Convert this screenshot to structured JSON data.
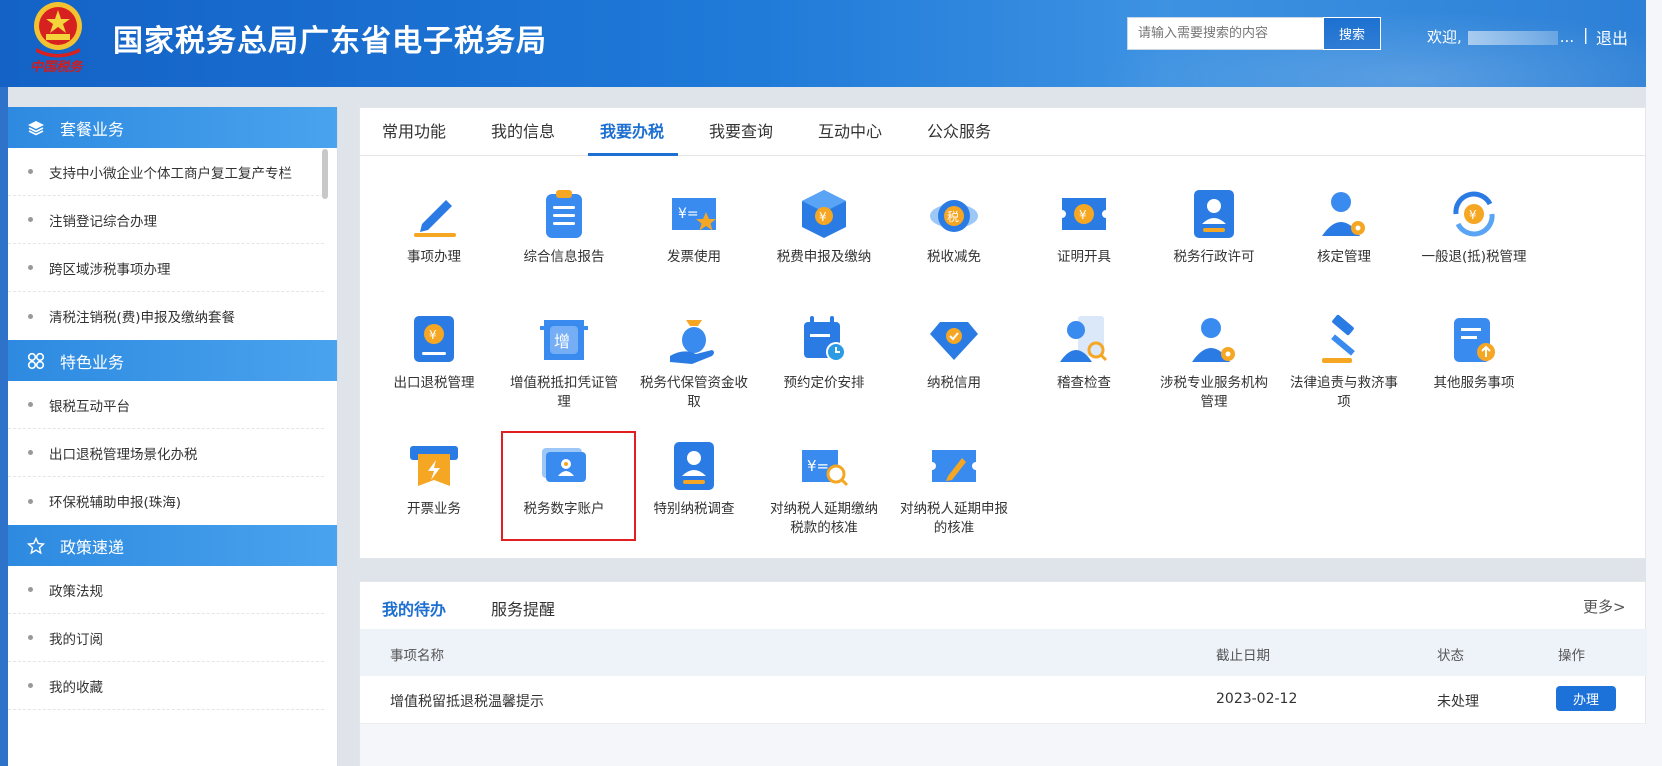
{
  "header": {
    "logo_script": "中国税务",
    "site_title": "国家税务总局广东省电子税务局",
    "search_placeholder": "请输入需要搜索的内容",
    "search_button": "搜索",
    "welcome": "欢迎,",
    "welcome_dots": "...",
    "separator": "|",
    "logout": "退出"
  },
  "sidebar": {
    "sections": [
      {
        "title": "套餐业务",
        "icon": "layers-icon",
        "items": [
          "支持中小微企业个体工商户复工复产专栏",
          "注销登记综合办理",
          "跨区域涉税事项办理",
          "清税注销税(费)申报及缴纳套餐"
        ]
      },
      {
        "title": "特色业务",
        "icon": "apps-icon",
        "items": [
          "银税互动平台",
          "出口退税管理场景化办税",
          "环保税辅助申报(珠海)"
        ]
      },
      {
        "title": "政策速递",
        "icon": "star-icon",
        "items": [
          "政策法规",
          "我的订阅",
          "我的收藏"
        ]
      }
    ]
  },
  "main": {
    "tabs": [
      "常用功能",
      "我的信息",
      "我要办税",
      "我要查询",
      "互动中心",
      "公众服务"
    ],
    "active_tab": "我要办税",
    "functions": [
      {
        "label": "事项办理",
        "icon": "pen-icon"
      },
      {
        "label": "综合信息报告",
        "icon": "clipboard-icon"
      },
      {
        "label": "发票使用",
        "icon": "invoice-star-icon"
      },
      {
        "label": "税费申报及缴纳",
        "icon": "box-yuan-icon"
      },
      {
        "label": "税收减免",
        "icon": "tax-reduction-icon"
      },
      {
        "label": "证明开具",
        "icon": "ticket-yuan-icon"
      },
      {
        "label": "税务行政许可",
        "icon": "license-person-icon"
      },
      {
        "label": "核定管理",
        "icon": "person-gear-icon"
      },
      {
        "label": "一般退(抵)税管理",
        "icon": "refund-cycle-icon"
      },
      {
        "label": "出口退税管理",
        "icon": "book-yuan-icon"
      },
      {
        "label": "增值税抵扣凭证管理",
        "icon": "vat-ticket-icon"
      },
      {
        "label": "税务代保管资金收取",
        "icon": "money-bag-hand-icon"
      },
      {
        "label": "预约定价安排",
        "icon": "calendar-clock-icon"
      },
      {
        "label": "纳税信用",
        "icon": "diamond-check-icon"
      },
      {
        "label": "稽查检查",
        "icon": "inspector-search-icon"
      },
      {
        "label": "涉税专业服务机构管理",
        "icon": "agent-gear-icon"
      },
      {
        "label": "法律追责与救济事项",
        "icon": "gavel-icon"
      },
      {
        "label": "其他服务事项",
        "icon": "doc-upload-icon"
      },
      {
        "label": "开票业务",
        "icon": "bolt-ticket-icon"
      },
      {
        "label": "税务数字账户",
        "icon": "digital-account-icon"
      },
      {
        "label": "特别纳税调查",
        "icon": "special-survey-icon"
      },
      {
        "label": "对纳税人延期缴纳税款的核准",
        "icon": "yuan-search-icon"
      },
      {
        "label": "对纳税人延期申报的核准",
        "icon": "ticket-pen-icon"
      }
    ],
    "highlighted": "税务数字账户"
  },
  "todo": {
    "tabs": [
      "我的待办",
      "服务提醒"
    ],
    "more": "更多>",
    "columns": [
      "事项名称",
      "截止日期",
      "状态",
      "操作"
    ],
    "rows": [
      {
        "name": "增值税留抵退税温馨提示",
        "deadline": "2023-02-12",
        "status": "未处理",
        "action": "办理"
      }
    ]
  },
  "colors": {
    "accent": "#1d6fd1",
    "header": "#1f7ad8",
    "highlight_border": "#e02020",
    "icon_orange": "#f5a623"
  }
}
